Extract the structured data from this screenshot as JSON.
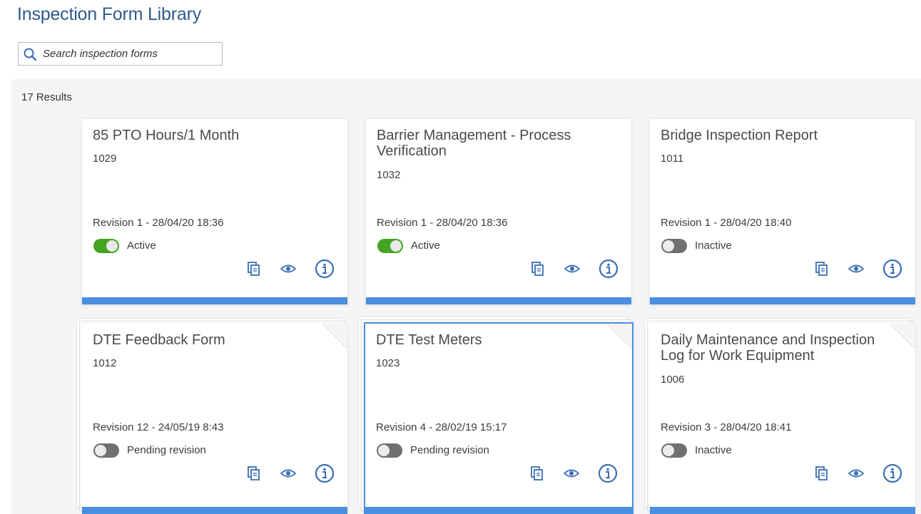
{
  "header": {
    "title": "Inspection Form Library"
  },
  "search": {
    "placeholder": "Search inspection forms",
    "value": ""
  },
  "results": {
    "count_label": "17 Results"
  },
  "colors": {
    "title": "#2e5a8c",
    "accent_bar": "#4a8fe0",
    "active_toggle": "#42a521",
    "inactive_toggle": "#707070",
    "icon": "#3b6fb5"
  },
  "icons": {
    "search": "search-icon",
    "copy": "copy-icon",
    "view": "eye-icon",
    "info": "info-icon"
  },
  "cards": [
    {
      "title": "85 PTO Hours/1 Month",
      "id": "1029",
      "revision": "Revision 1 - 28/04/20 18:36",
      "status": "Active"
    },
    {
      "title": "Barrier Management - Process Verification",
      "id": "1032",
      "revision": "Revision 1 - 28/04/20 18:36",
      "status": "Active"
    },
    {
      "title": "Bridge Inspection Report",
      "id": "1011",
      "revision": "Revision 1 - 28/04/20 18:40",
      "status": "Inactive"
    },
    {
      "title": "DTE Feedback Form",
      "id": "1012",
      "revision": "Revision 12 - 24/05/19 8:43",
      "status": "Pending revision"
    },
    {
      "title": "DTE Test Meters",
      "id": "1023",
      "revision": "Revision 4 - 28/02/19 15:17",
      "status": "Pending revision"
    },
    {
      "title": "Daily Maintenance and Inspection Log for Work Equipment",
      "id": "1006",
      "revision": "Revision 3 - 28/04/20 18:41",
      "status": "Inactive"
    }
  ]
}
